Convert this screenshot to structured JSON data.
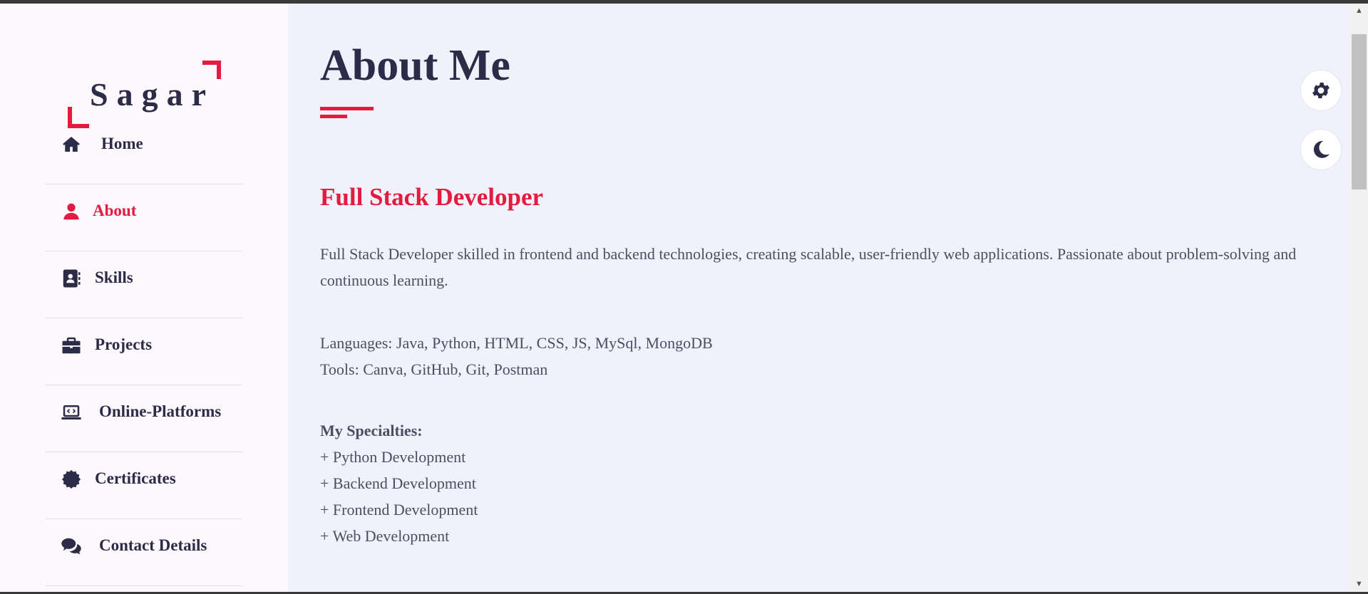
{
  "logo": {
    "text": "Sagar"
  },
  "nav": [
    {
      "label": "Home",
      "icon": "home-icon",
      "active": false
    },
    {
      "label": "About",
      "icon": "user-icon",
      "active": true
    },
    {
      "label": "Skills",
      "icon": "address-book-icon",
      "active": false
    },
    {
      "label": "Projects",
      "icon": "briefcase-icon",
      "active": false
    },
    {
      "label": "Online-Platforms",
      "icon": "laptop-code-icon",
      "active": false
    },
    {
      "label": "Certificates",
      "icon": "certificate-icon",
      "active": false
    },
    {
      "label": "Contact Details",
      "icon": "comments-icon",
      "active": false
    }
  ],
  "main": {
    "title": "About Me",
    "subtitle": "Full Stack Developer",
    "bio": "Full Stack Developer skilled in frontend and backend technologies, creating scalable, user-friendly web applications. Passionate about problem-solving and continuous learning.",
    "languages": "Languages: Java, Python, HTML, CSS, JS, MySql, MongoDB",
    "tools": "Tools: Canva, GitHub, Git, Postman",
    "specialties_title": "My Specialties:",
    "specialties": [
      "+ Python Development",
      "+ Backend Development",
      "+ Frontend Development",
      "+ Web Development"
    ]
  },
  "buttons": {
    "settings_icon": "gear-icon",
    "theme_icon": "moon-icon"
  },
  "colors": {
    "accent": "#e31b40",
    "text": "#2c2c48",
    "body_text": "#4d4d63",
    "sidebar_bg": "#fdf8fc",
    "main_bg": "#f0f1fa"
  }
}
